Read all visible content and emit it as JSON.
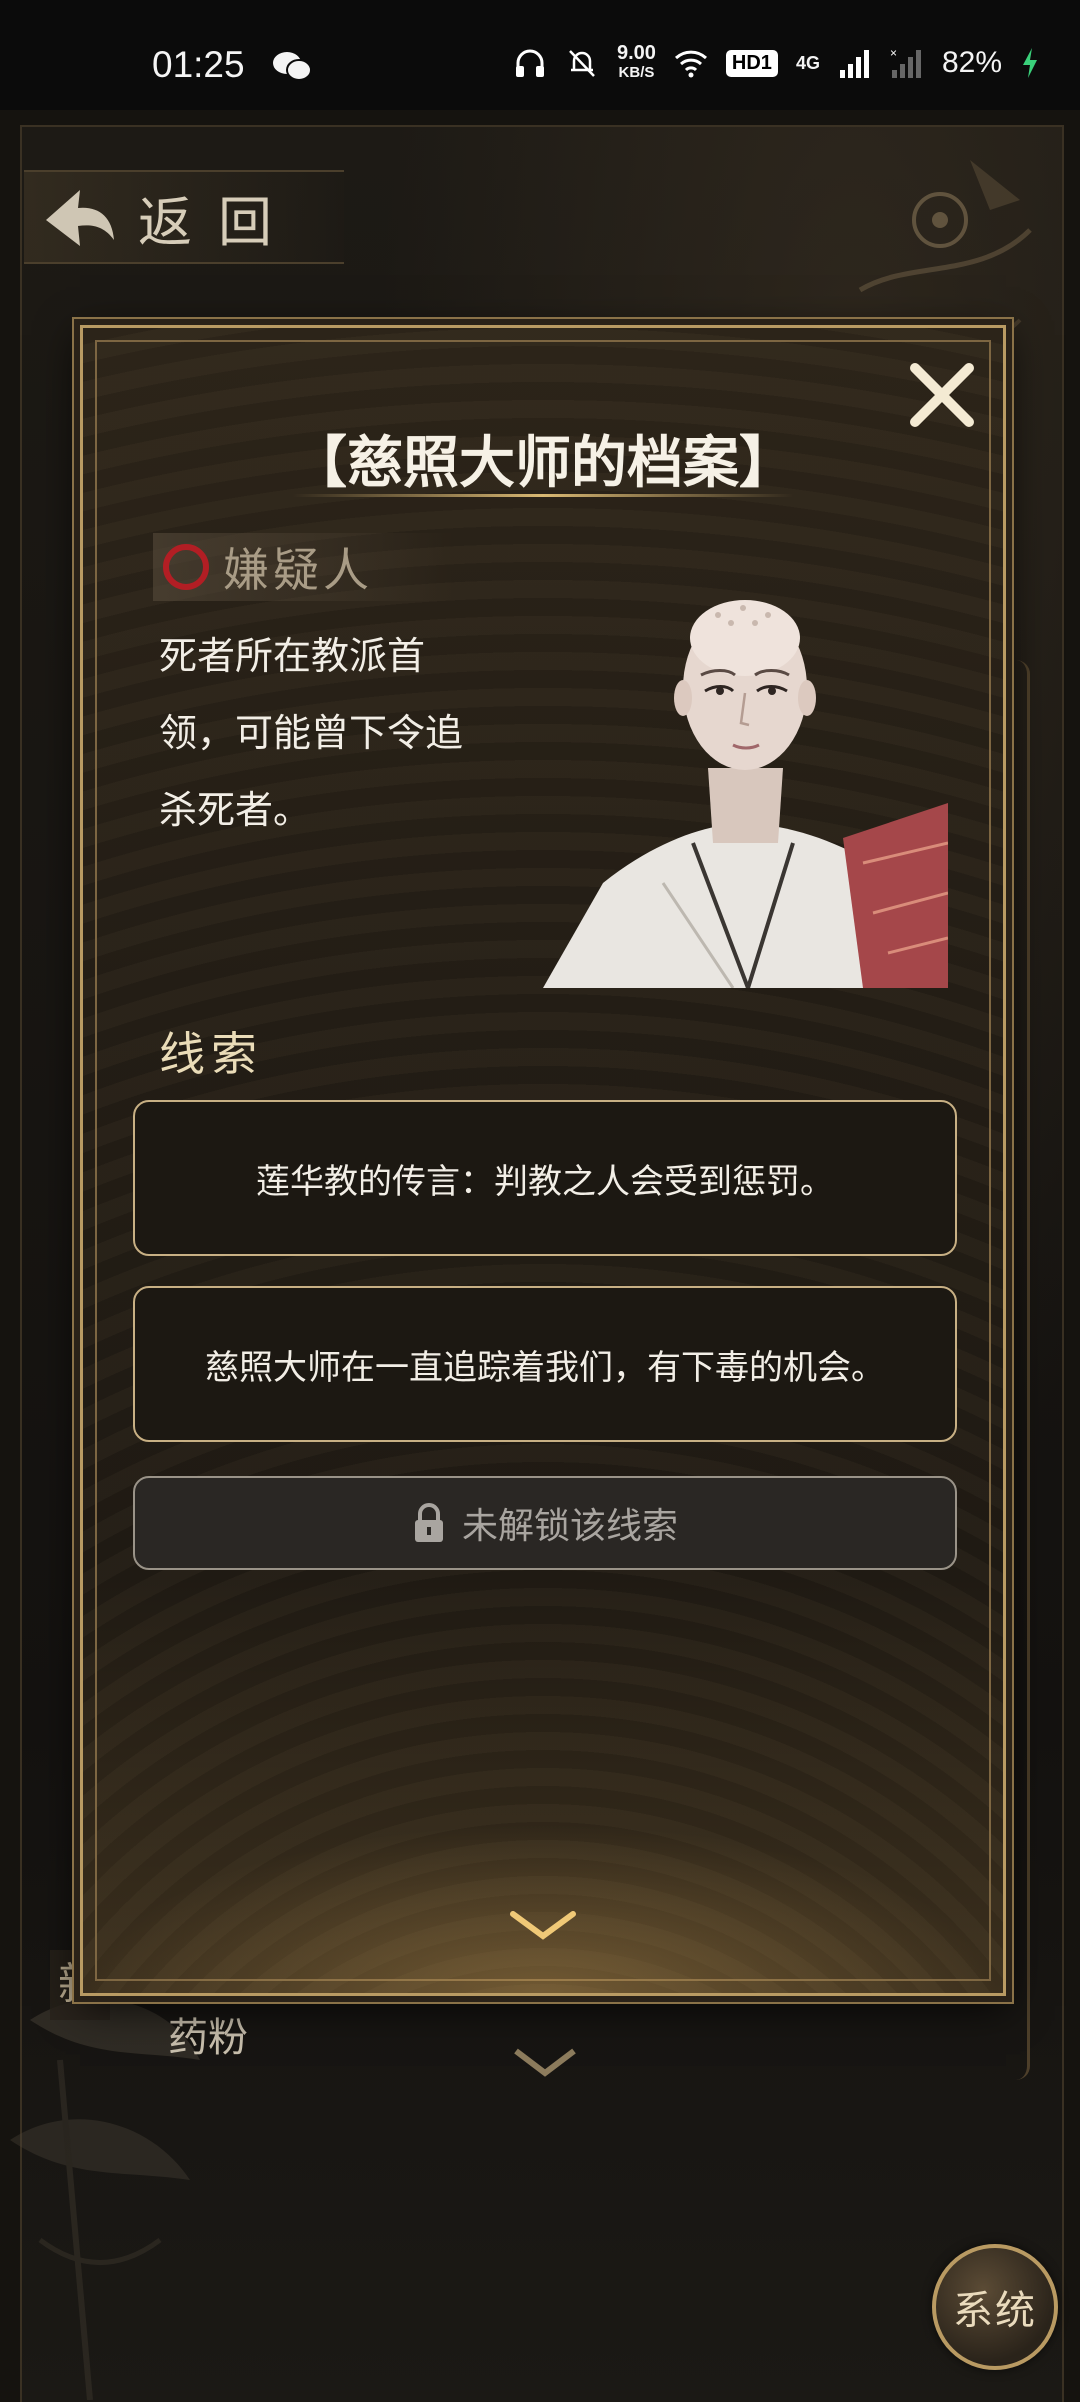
{
  "status_bar": {
    "time": "01:25",
    "speed_value": "9.00",
    "speed_unit": "KB/S",
    "hd_badge": "HD1",
    "network": "4G",
    "battery": "82%"
  },
  "background": {
    "back_label": "返回",
    "new_badge": "新",
    "list_item_partial": "药粉",
    "system_button": "系统"
  },
  "modal": {
    "title": "【慈照大师的档案】",
    "role_tag": "嫌疑人",
    "description": "死者所在教派首领，可能曾下令追杀死者。",
    "clues_heading": "线索",
    "clues": [
      "莲华教的传言：判教之人会受到惩罚。",
      "慈照大师在一直追踪着我们，有下毒的机会。"
    ],
    "locked_clue": "未解锁该线索"
  },
  "colors": {
    "gold": "#d9b873",
    "role_circle": "#b21e24",
    "robe_red": "#a5474a"
  }
}
